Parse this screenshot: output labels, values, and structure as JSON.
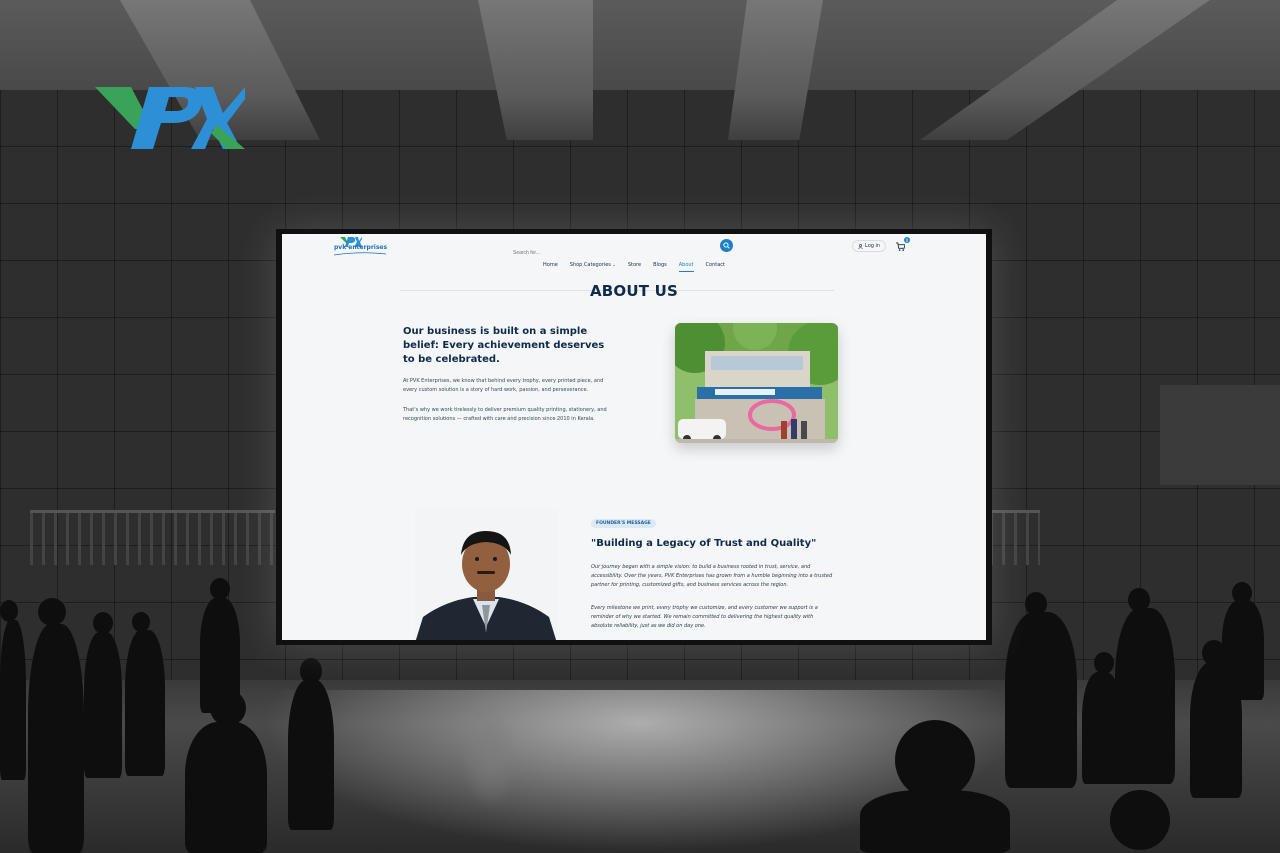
{
  "brand": {
    "wall_logo": "PVK",
    "site_logo_text": "pvk enterprises"
  },
  "header": {
    "search_placeholder": "Search for...",
    "login_label": "Log in",
    "cart_count": "0"
  },
  "nav": {
    "items": [
      "Home",
      "Shop Categories",
      "Store",
      "Blogs",
      "About",
      "Contact"
    ],
    "active": "About"
  },
  "about": {
    "title": "ABOUT US",
    "headline": "Our business is built on a simple belief: Every achievement deserves to be celebrated.",
    "para1": "At PVK Enterprises, we know that behind every trophy, every printed piece, and every custom solution is a story of hard work, passion, and perseverance.",
    "para2": "That's why we work tirelessly to deliver premium quality printing, stationery, and recognition solutions — crafted with care and precision since 2010 in Kerala."
  },
  "founder": {
    "badge": "FOUNDER'S MESSAGE",
    "title": "\"Building a Legacy of Trust and Quality\"",
    "para1": "Our journey began with a simple vision: to build a business rooted in trust, service, and accessibility. Over the years, PVK Enterprises has grown from a humble beginning into a trusted partner for printing, customized gifts, and business services across the region.",
    "para2": "Every milestone we print, every trophy we customize, and every customer we support is a reminder of why we started. We remain committed to delivering the highest quality with absolute reliability, just as we did on day one."
  },
  "colors": {
    "accent": "#1f7fc7",
    "heading": "#0f2a4a",
    "logo_blue": "#2d8fd5",
    "logo_green": "#3aa35a"
  }
}
